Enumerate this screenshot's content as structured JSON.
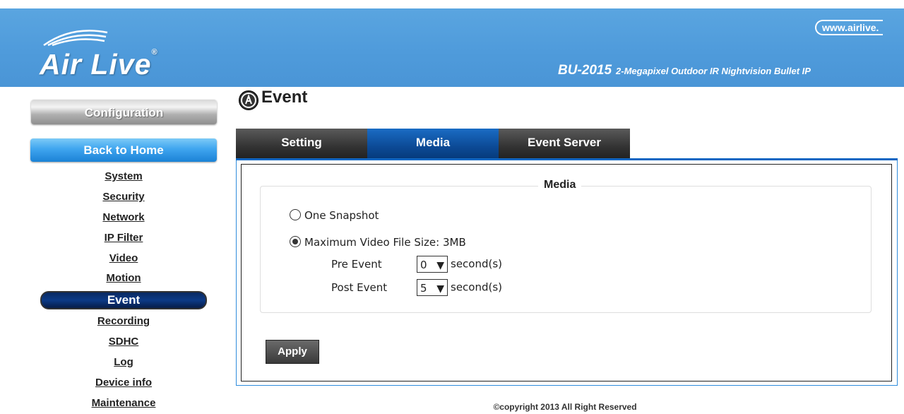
{
  "header": {
    "logo_text": "Air Live",
    "website": "www.airlive.",
    "model": "BU-2015",
    "model_desc": "2-Megapixel Outdoor IR Nightvision Bullet IP"
  },
  "sidebar": {
    "config_label": "Configuration",
    "home_label": "Back to Home",
    "items": [
      {
        "label": "System"
      },
      {
        "label": "Security"
      },
      {
        "label": "Network"
      },
      {
        "label": "IP Filter"
      },
      {
        "label": "Video"
      },
      {
        "label": "Motion"
      },
      {
        "label": "Event"
      },
      {
        "label": "Recording"
      },
      {
        "label": "SDHC"
      },
      {
        "label": "Log"
      },
      {
        "label": "Device info"
      },
      {
        "label": "Maintenance"
      }
    ]
  },
  "page": {
    "title": "Event",
    "tabs": [
      {
        "label": "Setting"
      },
      {
        "label": "Media"
      },
      {
        "label": "Event Server"
      }
    ],
    "section_title": "Media",
    "option_snapshot": "One Snapshot",
    "option_video": "Maximum Video File Size: 3MB",
    "pre_label": "Pre Event",
    "pre_value": "0",
    "post_label": "Post Event",
    "post_value": "5",
    "unit": "second(s)",
    "apply_label": "Apply"
  },
  "footer": {
    "copyright": "©copyright 2013 All Right Reserved"
  },
  "colors": {
    "banner": "#4f9bdb",
    "active_tab": "#0c4a96",
    "nav_active": "#0c3a86"
  }
}
